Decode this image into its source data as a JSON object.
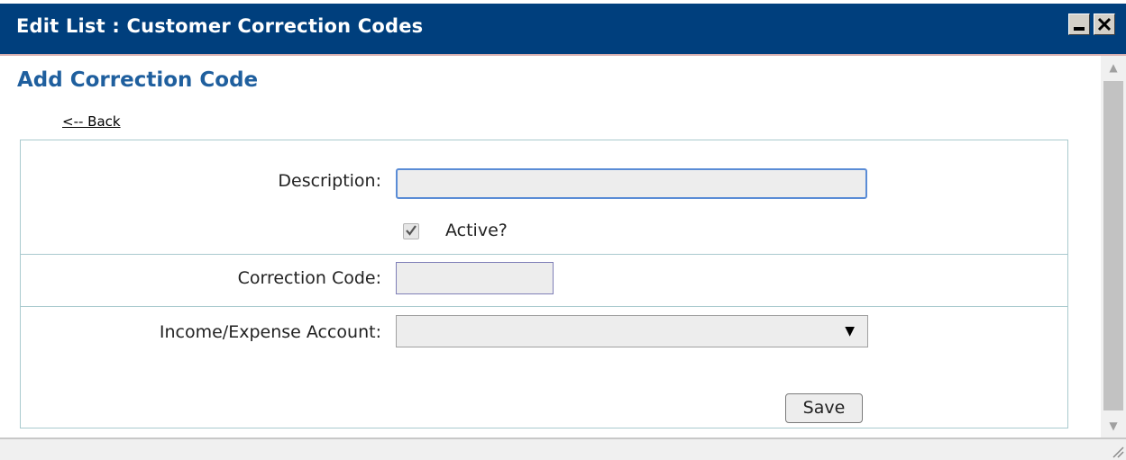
{
  "window": {
    "title": "Edit List : Customer Correction Codes",
    "minimize_icon": "minimize-icon",
    "close_icon": "close-icon"
  },
  "page": {
    "heading": "Add Correction Code",
    "back_link": "<-- Back"
  },
  "form": {
    "description": {
      "label": "Description:",
      "value": ""
    },
    "active": {
      "label": "Active?",
      "checked": true
    },
    "correction_code": {
      "label": "Correction Code:",
      "value": ""
    },
    "account": {
      "label": "Income/Expense Account:",
      "selected": ""
    },
    "save_label": "Save"
  },
  "colors": {
    "titlebar": "#003F7D",
    "heading": "#1F5F9E",
    "border": "#A9CACE"
  }
}
